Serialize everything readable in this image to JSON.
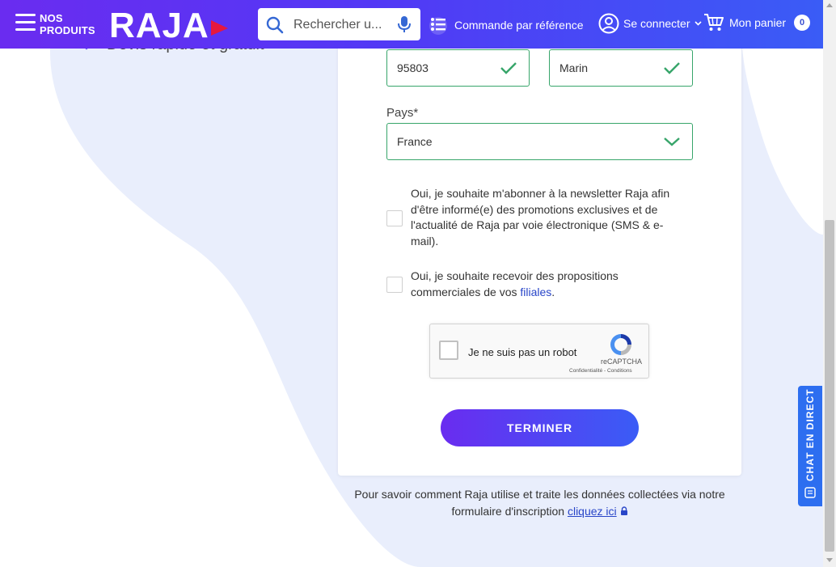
{
  "header": {
    "menu_label_line1": "NOS",
    "menu_label_line2": "PRODUITS",
    "logo_text": "RAJA",
    "search_placeholder": "Rechercher u...",
    "order_by_ref": "Commande par référence",
    "login": "Se connecter",
    "cart": "Mon panier",
    "cart_count": "0"
  },
  "left": {
    "feature": "Devis rapide et gratuit"
  },
  "form": {
    "postal_code": "95803",
    "city": "Marin",
    "country_label": "Pays*",
    "country_value": "France",
    "newsletter_text": "Oui, je souhaite m'abonner à la newsletter Raja afin d'être informé(e) des promotions exclusives et de l'actualité de Raja par voie électronique (SMS & e-mail).",
    "offers_text": "Oui, je souhaite recevoir des propositions commerciales de vos",
    "offers_link": "filiales",
    "offers_end": ".",
    "submit": "TERMINER"
  },
  "captcha": {
    "label": "Je ne suis pas un robot",
    "brand": "reCAPTCHA",
    "links": "Confidentialité - Conditions"
  },
  "footer": {
    "note": "Pour savoir comment Raja utilise et traite les données collectées via notre formulaire d'inscription",
    "link": "cliquez ici"
  },
  "chat": {
    "label": "CHAT EN DIRECT"
  },
  "colors": {
    "brand_purple": "#6a2cf0",
    "brand_blue": "#3a5cf6",
    "valid_green": "#37a56a",
    "blob": "#e9eefc"
  }
}
